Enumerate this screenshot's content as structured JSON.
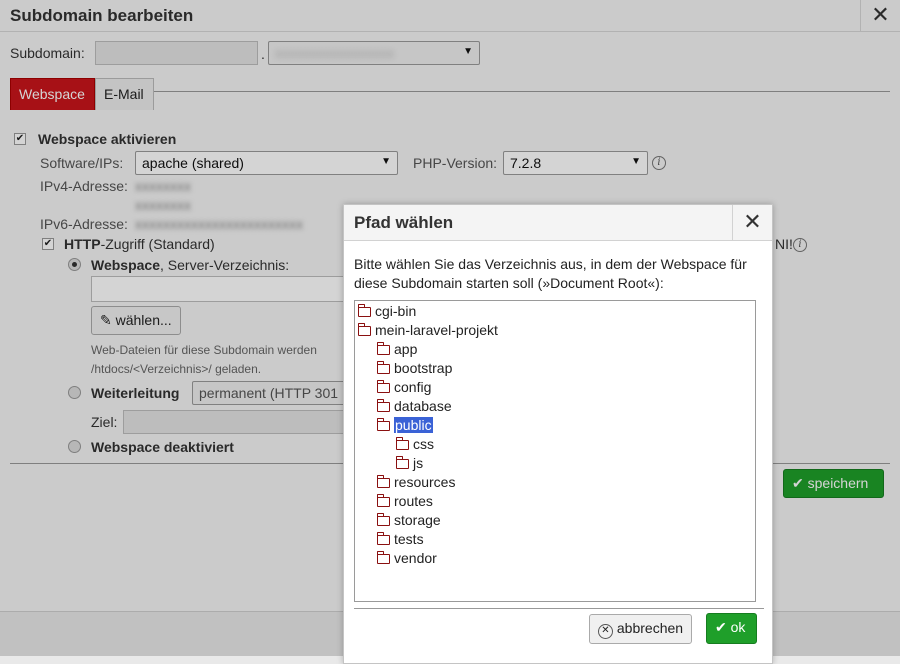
{
  "main": {
    "title": "Subdomain bearbeiten",
    "subdomain_label": "Subdomain:",
    "subdomain_dot": ".",
    "tabs": [
      {
        "label": "Webspace",
        "active": true
      },
      {
        "label": "E-Mail",
        "active": false
      }
    ],
    "webspace_activate_label": "Webspace aktivieren",
    "software_label": "Software/IPs:",
    "software_value": "apache (shared)",
    "php_label": "PHP-Version:",
    "php_value": "7.2.8",
    "ipv4_label": "IPv4-Adresse:",
    "ipv6_label": "IPv6-Adresse:",
    "http_label_bold": "HTTP",
    "http_label_rest": "-Zugriff (Standard)",
    "ni_suffix": "NI!",
    "webspace_radio_bold": "Webspace",
    "webspace_radio_rest": ", Server-Verzeichnis:",
    "choose_button": "wählen...",
    "help_line1": "Web-Dateien für diese Subdomain werden",
    "help_line2": "/htdocs/<Verzeichnis>/ geladen.",
    "redirect_label": "Weiterleitung",
    "redirect_select": "permanent (HTTP 301",
    "target_label": "Ziel:",
    "deactivated_label": "Webspace deaktiviert",
    "save_button": "speichern"
  },
  "path_dialog": {
    "title": "Pfad wählen",
    "instruction": "Bitte wählen Sie das Verzeichnis aus, in dem der Webspace für diese Subdomain starten soll (»Document Root«):",
    "tree": [
      {
        "label": "cgi-bin",
        "level": 0,
        "selected": false
      },
      {
        "label": "mein-laravel-projekt",
        "level": 0,
        "selected": false
      },
      {
        "label": "app",
        "level": 1,
        "selected": false
      },
      {
        "label": "bootstrap",
        "level": 1,
        "selected": false
      },
      {
        "label": "config",
        "level": 1,
        "selected": false
      },
      {
        "label": "database",
        "level": 1,
        "selected": false
      },
      {
        "label": "public",
        "level": 1,
        "selected": true
      },
      {
        "label": "css",
        "level": 2,
        "selected": false
      },
      {
        "label": "js",
        "level": 2,
        "selected": false
      },
      {
        "label": "resources",
        "level": 1,
        "selected": false
      },
      {
        "label": "routes",
        "level": 1,
        "selected": false
      },
      {
        "label": "storage",
        "level": 1,
        "selected": false
      },
      {
        "label": "tests",
        "level": 1,
        "selected": false
      },
      {
        "label": "vendor",
        "level": 1,
        "selected": false
      }
    ],
    "cancel_button": "abbrechen",
    "ok_button": "ok"
  },
  "colors": {
    "accent_red": "#c9151b",
    "confirm_green": "#1f9f2a",
    "selection_blue": "#3a62d6",
    "folder_icon": "#8a1010"
  },
  "icons": {
    "close": "close-icon",
    "folder": "folder-icon",
    "pencil": "pencil-icon",
    "check": "check-icon",
    "cancel": "cancel-circle-icon",
    "info": "info-icon"
  }
}
